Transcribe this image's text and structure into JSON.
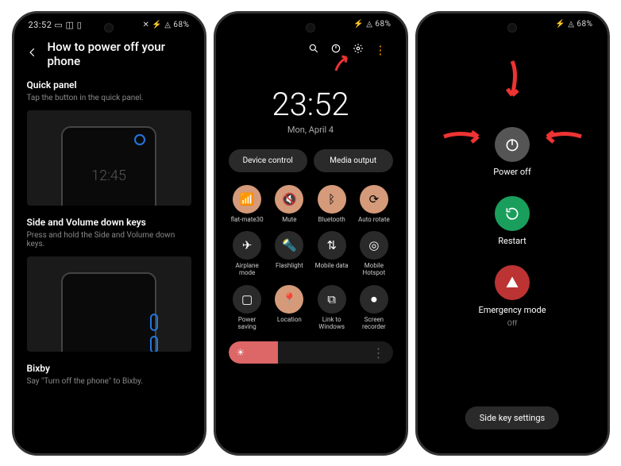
{
  "status": {
    "time": "23:52",
    "left_icons": "▭ ◫ ▯",
    "right_icons": "✕ ⚡ ◬ 68%",
    "right_icons2": "⚡ ◬ 68%"
  },
  "phone1": {
    "title": "How to power off your phone",
    "s1_title": "Quick panel",
    "s1_sub": "Tap the button in the quick panel.",
    "illus_time": "12:45",
    "s2_title": "Side and Volume down keys",
    "s2_sub": "Press and hold the Side and Volume down keys.",
    "s3_title": "Bixby",
    "s3_sub": "Say \"Turn off the phone\" to Bixby."
  },
  "phone2": {
    "clock_time": "23:52",
    "clock_date": "Mon, April 4",
    "pill_device": "Device control",
    "pill_media": "Media output",
    "tiles": [
      {
        "label": "flat-mate30",
        "icon": "wifi",
        "active": true
      },
      {
        "label": "Mute",
        "icon": "mute",
        "active": true
      },
      {
        "label": "Bluetooth",
        "icon": "bt",
        "active": true
      },
      {
        "label": "Auto rotate",
        "icon": "rotate",
        "active": true
      },
      {
        "label": "Airplane mode",
        "icon": "plane",
        "active": false
      },
      {
        "label": "Flashlight",
        "icon": "flash",
        "active": false
      },
      {
        "label": "Mobile data",
        "icon": "data",
        "active": false
      },
      {
        "label": "Mobile Hotspot",
        "icon": "hotspot",
        "active": false
      },
      {
        "label": "Power saving",
        "icon": "leaf",
        "active": false
      },
      {
        "label": "Location",
        "icon": "loc",
        "active": true
      },
      {
        "label": "Link to Windows",
        "icon": "link",
        "active": false
      },
      {
        "label": "Screen recorder",
        "icon": "rec",
        "active": false
      }
    ]
  },
  "phone3": {
    "power_off": "Power off",
    "restart": "Restart",
    "emergency": "Emergency mode",
    "emergency_sub": "Off",
    "side_key": "Side key settings"
  },
  "icons": {
    "wifi": "📶",
    "mute": "🔇",
    "bt": "ᛒ",
    "rotate": "⟳",
    "plane": "✈",
    "flash": "🔦",
    "data": "⇅",
    "hotspot": "◎",
    "leaf": "▢",
    "loc": "📍",
    "link": "⧉",
    "rec": "⏺"
  }
}
